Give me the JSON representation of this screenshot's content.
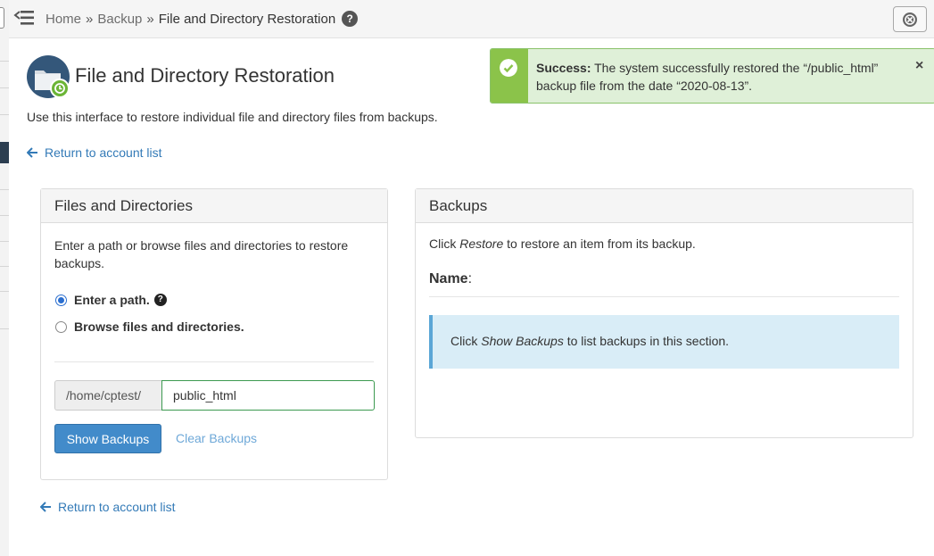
{
  "breadcrumb": {
    "items": [
      "Home",
      "Backup"
    ],
    "separator": "»",
    "current": "File and Directory Restoration",
    "help_glyph": "?"
  },
  "page": {
    "title": "File and Directory Restoration",
    "description": "Use this interface to restore individual file and directory files from backups.",
    "back_link_top": "Return to account list",
    "back_link_bottom": "Return to account list"
  },
  "alert": {
    "type": "success",
    "strong": "Success:",
    "line1": " The system successfully restored the “/public_html”",
    "line2": "backup file from the date “2020-08-13”.",
    "close_glyph": "×",
    "color": "#dff0d8",
    "accent": "#8bc34a"
  },
  "files_panel": {
    "title": "Files and Directories",
    "description": "Enter a path or browse files and directories to restore backups.",
    "radio_path_label": "Enter a path.",
    "radio_path_help": "?",
    "radio_browse_label": "Browse files and directories.",
    "selected_option": "Enter a path.",
    "path_prefix": "/home/cptest/",
    "path_value": "public_html",
    "show_backups_label": "Show Backups",
    "clear_backups_label": "Clear Backups"
  },
  "backups_panel": {
    "title": "Backups",
    "instruction_pre": "Click ",
    "instruction_em": "Restore",
    "instruction_post": " to restore an item from its backup.",
    "name_label": "Name",
    "name_colon": ":",
    "info_pre": "Click ",
    "info_em": "Show Backups",
    "info_post": " to list backups in this section."
  },
  "icons": {
    "menu_toggle": "menu-collapse-icon",
    "help": "question-circle-icon",
    "close_session": "close-circle-icon",
    "page": "folder-restore-icon",
    "back": "arrow-left-icon",
    "success": "check-circle-icon"
  },
  "colors": {
    "link": "#337ab7",
    "primary": "#428bca",
    "info": "#d9edf7"
  }
}
